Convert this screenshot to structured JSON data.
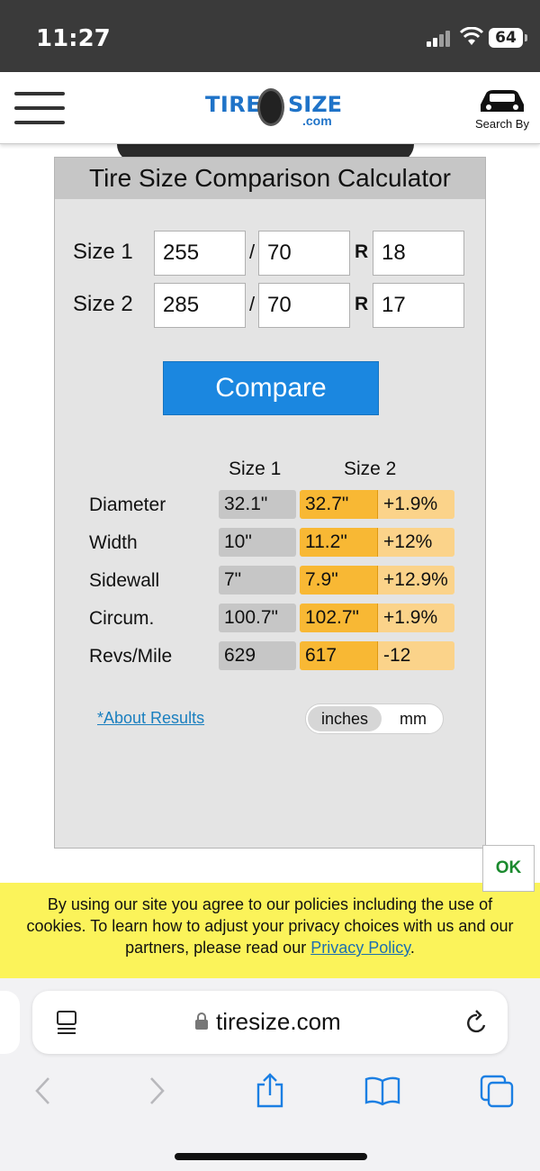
{
  "status_bar": {
    "time": "11:27",
    "battery": "64"
  },
  "header": {
    "logo_left": "TIRE",
    "logo_right": "SIZE",
    "logo_com": ".com",
    "search_by": "Search By"
  },
  "calculator": {
    "title": "Tire Size Comparison Calculator",
    "size1": {
      "label": "Size 1",
      "width": "255",
      "aspect": "70",
      "rim": "18"
    },
    "size2": {
      "label": "Size 2",
      "width": "285",
      "aspect": "70",
      "rim": "17"
    },
    "separator": "/",
    "rim_prefix": "R",
    "compare_label": "Compare",
    "columns": {
      "size1": "Size 1",
      "size2": "Size 2"
    },
    "results": [
      {
        "label": "Diameter",
        "size1": "32.1\"",
        "size2": "32.7\"",
        "diff": "+1.9%"
      },
      {
        "label": "Width",
        "size1": "10\"",
        "size2": "11.2\"",
        "diff": "+12%"
      },
      {
        "label": "Sidewall",
        "size1": "7\"",
        "size2": "7.9\"",
        "diff": "+12.9%"
      },
      {
        "label": "Circum.",
        "size1": "100.7\"",
        "size2": "102.7\"",
        "diff": "+1.9%"
      },
      {
        "label": "Revs/Mile",
        "size1": "629",
        "size2": "617",
        "diff": "-12"
      }
    ],
    "about_link": "*About Results",
    "units": {
      "selected": "inches",
      "options": [
        "inches",
        "mm"
      ]
    }
  },
  "cookie": {
    "text": "By using our site you agree to our policies including the use of cookies. To learn how to adjust your privacy choices with us and our partners, please read our ",
    "link": "Privacy Policy",
    "end": ".",
    "ok": "OK"
  },
  "browser": {
    "url": "tiresize.com"
  },
  "colors": {
    "accent": "#1b87e0",
    "size2_fill": "#f8b834",
    "diff_fill": "#fbd38a",
    "banner": "#fbf35a"
  }
}
